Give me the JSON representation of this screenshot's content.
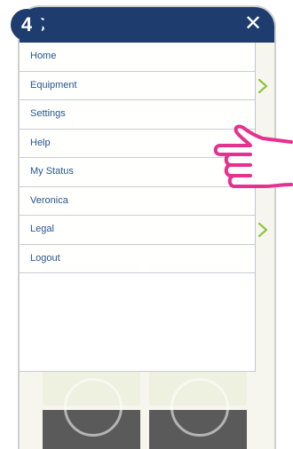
{
  "step_badge": "4",
  "header": {
    "close_glyph": "✕",
    "logo_icon": "app-logo-icon"
  },
  "menu": {
    "items": [
      {
        "label": "Home",
        "has_submenu": false
      },
      {
        "label": "Equipment",
        "has_submenu": true
      },
      {
        "label": "Settings",
        "has_submenu": false
      },
      {
        "label": "Help",
        "has_submenu": false
      },
      {
        "label": "My Status",
        "has_submenu": false
      },
      {
        "label": "Veronica",
        "has_submenu": false
      },
      {
        "label": "Legal",
        "has_submenu": true
      },
      {
        "label": "Logout",
        "has_submenu": false
      }
    ]
  },
  "colors": {
    "header": "#1e3d6e",
    "menu_text": "#27558c",
    "chevron": "#8dc63f",
    "hand_outline": "#e6318f"
  }
}
